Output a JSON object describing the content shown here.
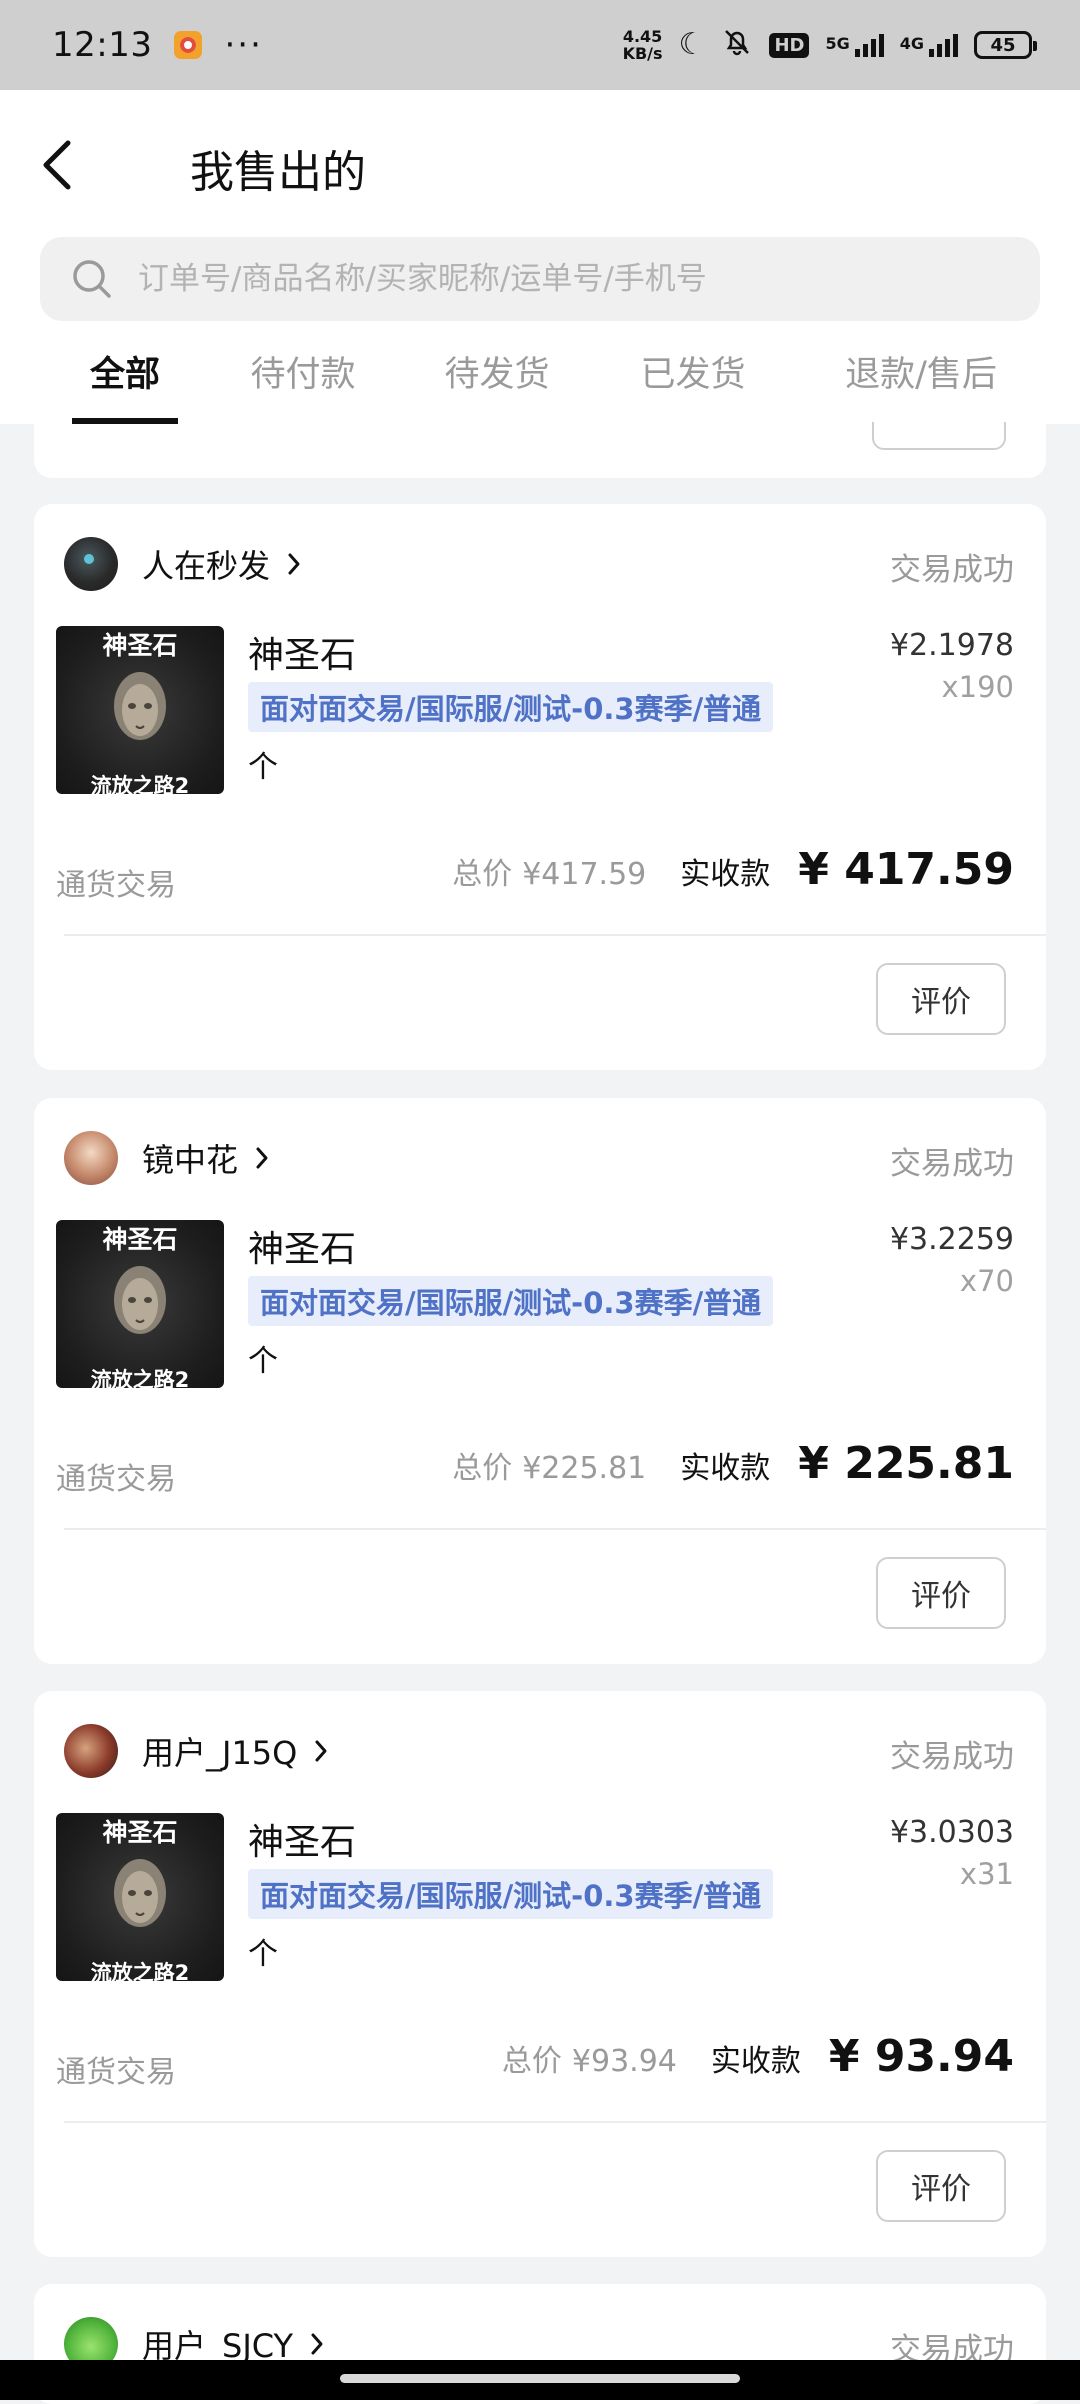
{
  "status_bar": {
    "time": "12:13",
    "more": "···",
    "net_speed_value": "4.45",
    "net_speed_unit": "KB/s",
    "hd_badge": "HD",
    "net_5g": "5G",
    "net_4g": "4G",
    "battery": "45"
  },
  "header": {
    "title": "我售出的"
  },
  "search": {
    "placeholder": "订单号/商品名称/买家昵称/运单号/手机号"
  },
  "tabs": [
    {
      "label": "全部",
      "active": true
    },
    {
      "label": "待付款",
      "active": false
    },
    {
      "label": "待发货",
      "active": false
    },
    {
      "label": "已发货",
      "active": false
    },
    {
      "label": "退款/售后",
      "active": false
    }
  ],
  "orders": [
    {
      "buyer": "人在秒发",
      "status": "交易成功",
      "product_name": "神圣石",
      "thumb_top": "神圣石",
      "thumb_bottom": "流放之路2",
      "tag": "面对面交易/国际服/测试-0.3赛季/普通",
      "unit": "个",
      "unit_price": "¥2.1978",
      "quantity": "x190",
      "trade_type": "通货交易",
      "total_label": "总价",
      "total": "¥417.59",
      "received_label": "实收款",
      "received": "¥ 417.59",
      "rate_label": "评价"
    },
    {
      "buyer": "镜中花",
      "status": "交易成功",
      "product_name": "神圣石",
      "thumb_top": "神圣石",
      "thumb_bottom": "流放之路2",
      "tag": "面对面交易/国际服/测试-0.3赛季/普通",
      "unit": "个",
      "unit_price": "¥3.2259",
      "quantity": "x70",
      "trade_type": "通货交易",
      "total_label": "总价",
      "total": "¥225.81",
      "received_label": "实收款",
      "received": "¥ 225.81",
      "rate_label": "评价"
    },
    {
      "buyer": "用户_J15Q",
      "status": "交易成功",
      "product_name": "神圣石",
      "thumb_top": "神圣石",
      "thumb_bottom": "流放之路2",
      "tag": "面对面交易/国际服/测试-0.3赛季/普通",
      "unit": "个",
      "unit_price": "¥3.0303",
      "quantity": "x31",
      "trade_type": "通货交易",
      "total_label": "总价",
      "total": "¥93.94",
      "received_label": "实收款",
      "received": "¥ 93.94",
      "rate_label": "评价"
    },
    {
      "buyer": "用户_SJCY",
      "status": "交易成功"
    }
  ],
  "colors": {
    "tag_bg": "#e7edfb",
    "tag_text": "#4f72c7",
    "page_bg": "#f2f3f5",
    "status_bar_bg": "#cfcfcf"
  }
}
